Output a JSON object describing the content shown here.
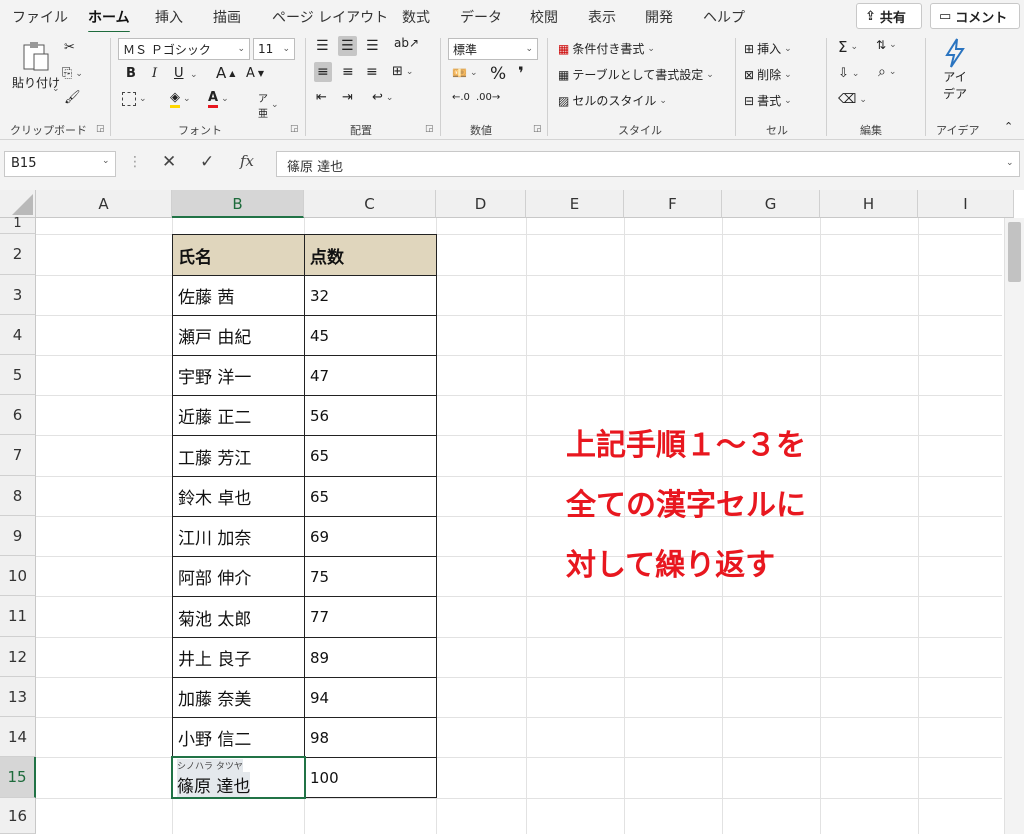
{
  "tabs": [
    "ファイル",
    "ホーム",
    "挿入",
    "描画",
    "ページ レイアウト",
    "数式",
    "データ",
    "校閲",
    "表示",
    "開発",
    "ヘルプ"
  ],
  "header_buttons": {
    "share": "共有",
    "comment": "コメント"
  },
  "ribbon": {
    "clipboard": {
      "paste": "貼り付け",
      "label": "クリップボード"
    },
    "font": {
      "name": "ＭＳ Ｐゴシック",
      "size": "11",
      "bold": "B",
      "italic": "I",
      "underline": "U",
      "grow": "A",
      "shrink": "A",
      "label": "フォント"
    },
    "alignment": {
      "label": "配置"
    },
    "number": {
      "format": "標準",
      "percent": "%",
      "comma": "❜",
      "label": "数値"
    },
    "styles": {
      "conditional": "条件付き書式",
      "table": "テーブルとして書式設定",
      "cell_styles": "セルのスタイル",
      "label": "スタイル"
    },
    "cells": {
      "insert": "挿入",
      "delete": "削除",
      "format": "書式",
      "label": "セル"
    },
    "editing": {
      "label": "編集"
    },
    "ideas": {
      "line1": "アイ",
      "line2": "デア",
      "label": "アイデア"
    }
  },
  "formula_bar": {
    "name_box": "B15",
    "fx": "fx",
    "content": "篠原 達也"
  },
  "columns": [
    "A",
    "B",
    "C",
    "D",
    "E",
    "F",
    "G",
    "H",
    "I"
  ],
  "rows": [
    "1",
    "2",
    "3",
    "4",
    "5",
    "6",
    "7",
    "8",
    "9",
    "10",
    "11",
    "12",
    "13",
    "14",
    "15",
    "16"
  ],
  "table": {
    "headers": [
      "氏名",
      "点数"
    ],
    "data": [
      [
        "佐藤 茜",
        "32"
      ],
      [
        "瀬戸 由紀",
        "45"
      ],
      [
        "宇野 洋一",
        "47"
      ],
      [
        "近藤 正二",
        "56"
      ],
      [
        "工藤 芳江",
        "65"
      ],
      [
        "鈴木 卓也",
        "65"
      ],
      [
        "江川 加奈",
        "69"
      ],
      [
        "阿部 伸介",
        "75"
      ],
      [
        "菊池 太郎",
        "77"
      ],
      [
        "井上 良子",
        "89"
      ],
      [
        "加藤 奈美",
        "94"
      ],
      [
        "小野 信二",
        "98"
      ],
      [
        "篠原 達也",
        "100"
      ]
    ],
    "furigana": "シノハラ タツヤ"
  },
  "annotation": [
    "上記手順１～３を",
    "全ての漢字セルに",
    "対して繰り返す"
  ],
  "colors": {
    "accent": "#217346",
    "header_fill": "#e0d6bd",
    "annotation": "#e8171f"
  }
}
